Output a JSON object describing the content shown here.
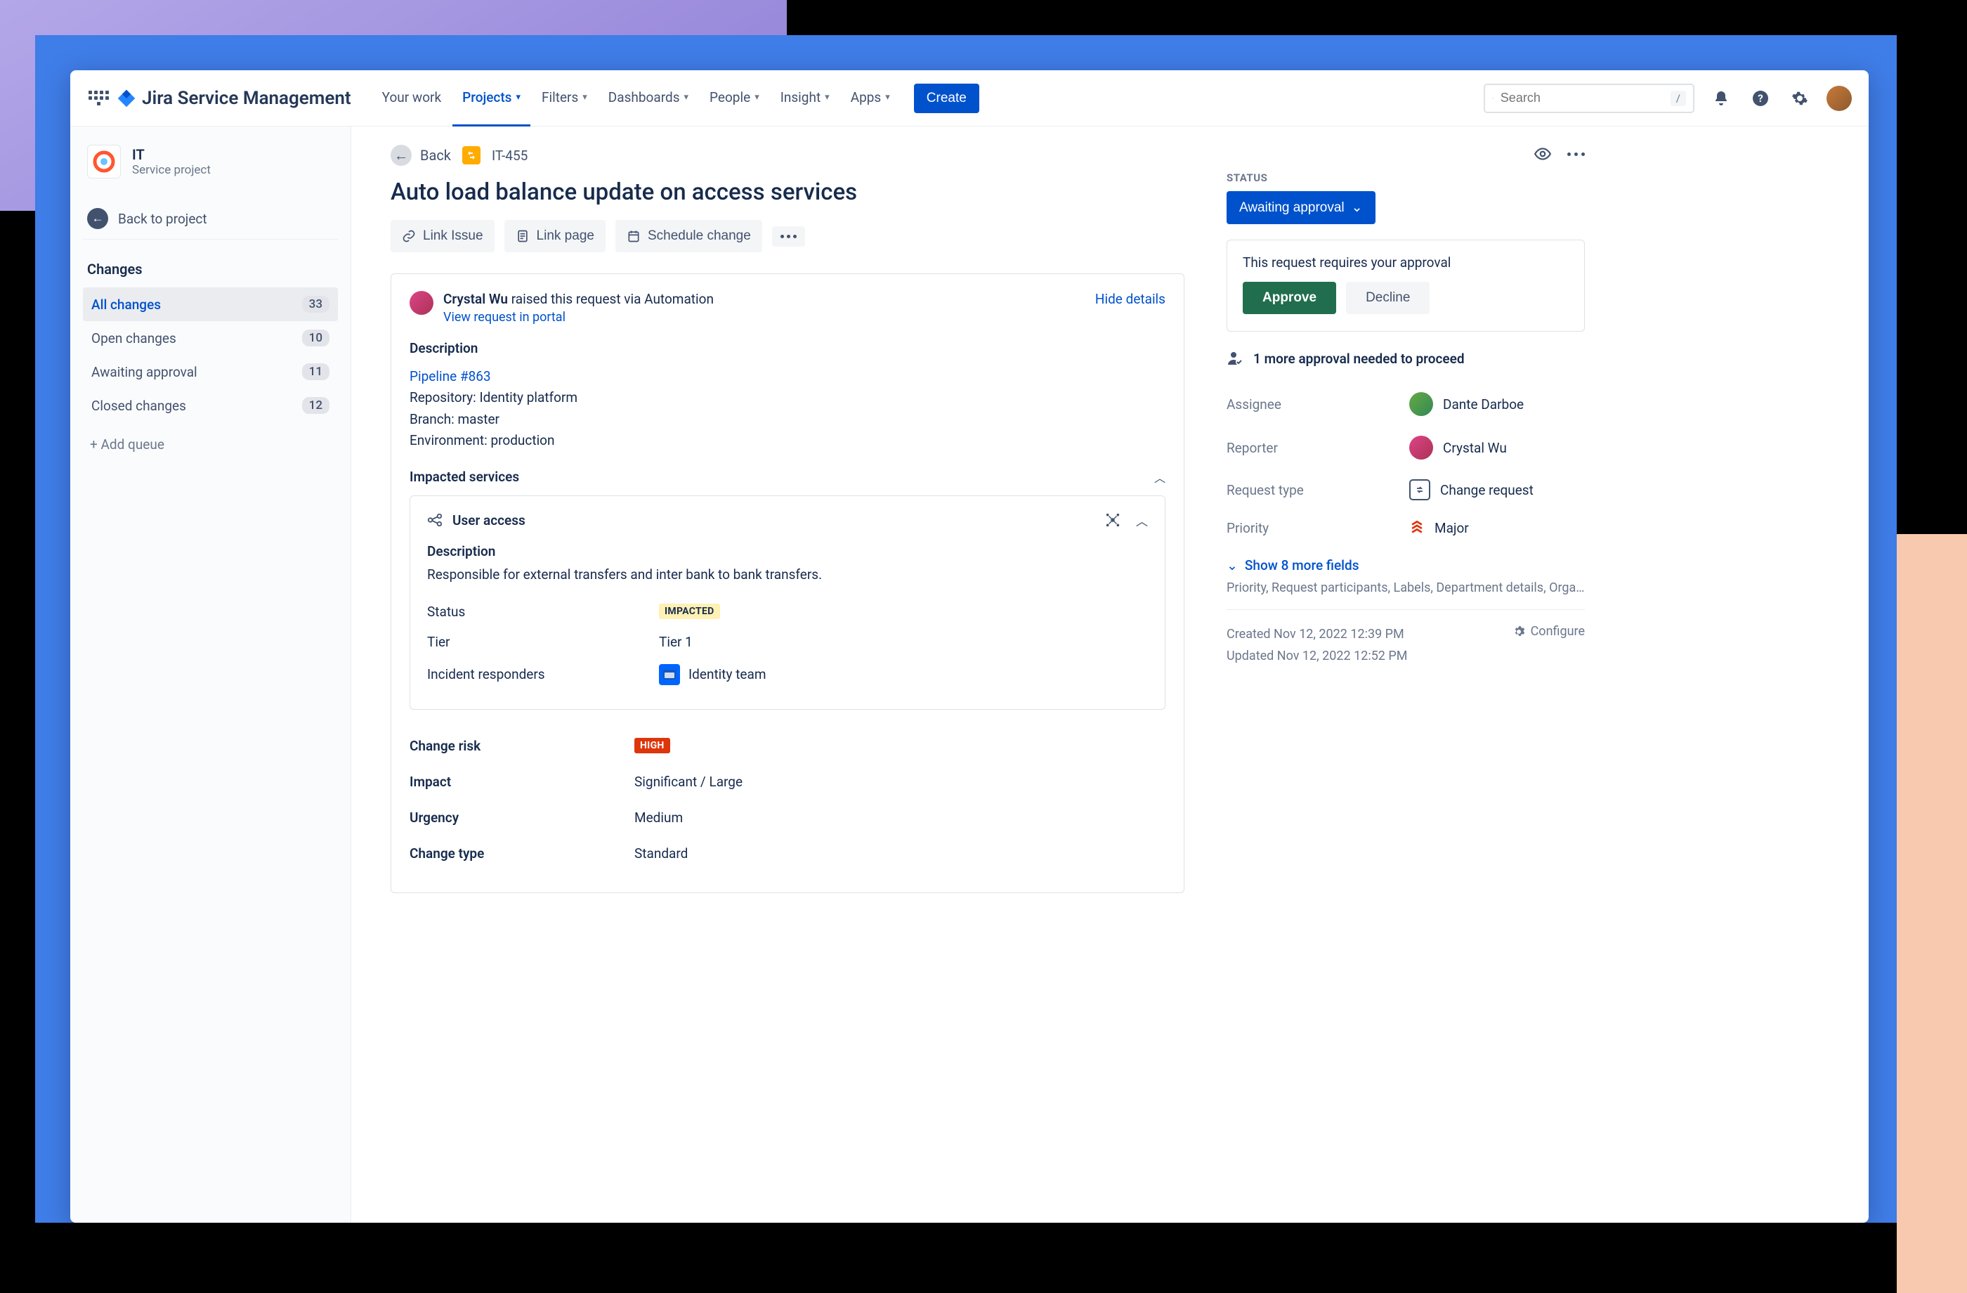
{
  "header": {
    "product": "Jira Service Management",
    "nav": {
      "your_work": "Your work",
      "projects": "Projects",
      "filters": "Filters",
      "dashboards": "Dashboards",
      "people": "People",
      "insight": "Insight",
      "apps": "Apps"
    },
    "create": "Create",
    "search_placeholder": "Search",
    "search_key": "/"
  },
  "sidebar": {
    "project_name": "IT",
    "project_type": "Service project",
    "back_to_project": "Back to project",
    "section": "Changes",
    "items": [
      {
        "label": "All changes",
        "count": "33"
      },
      {
        "label": "Open changes",
        "count": "10"
      },
      {
        "label": "Awaiting approval",
        "count": "11"
      },
      {
        "label": "Closed changes",
        "count": "12"
      }
    ],
    "add_queue": "+ Add queue"
  },
  "issue": {
    "back": "Back",
    "key": "IT-455",
    "title": "Auto load balance update on access services",
    "actions": {
      "link_issue": "Link Issue",
      "link_page": "Link page",
      "schedule": "Schedule change"
    },
    "requester": {
      "name": "Crystal Wu",
      "suffix": " raised this request via Automation"
    },
    "view_in_portal": "View request in portal",
    "hide_details": "Hide details",
    "desc_label": "Description",
    "desc": {
      "pipeline": "Pipeline #863",
      "repo": "Repository: Identity platform",
      "branch": "Branch: master",
      "env": "Environment: production"
    },
    "impacted_label": "Impacted services",
    "service": {
      "name": "User access",
      "desc_label": "Description",
      "desc": "Responsible for external transfers and inter bank to bank transfers.",
      "status_k": "Status",
      "status_v": "IMPACTED",
      "tier_k": "Tier",
      "tier_v": "Tier 1",
      "responders_k": "Incident responders",
      "responders_v": "Identity team"
    },
    "fields": {
      "risk_k": "Change risk",
      "risk_v": "HIGH",
      "impact_k": "Impact",
      "impact_v": "Significant / Large",
      "urgency_k": "Urgency",
      "urgency_v": "Medium",
      "type_k": "Change type",
      "type_v": "Standard"
    }
  },
  "right": {
    "status_label": "STATUS",
    "status_value": "Awaiting approval",
    "approval_text": "This request requires your approval",
    "approve": "Approve",
    "decline": "Decline",
    "approval_needed": "1 more approval needed to proceed",
    "assignee_k": "Assignee",
    "assignee_v": "Dante Darboe",
    "reporter_k": "Reporter",
    "reporter_v": "Crystal Wu",
    "reqtype_k": "Request type",
    "reqtype_v": "Change request",
    "priority_k": "Priority",
    "priority_v": "Major",
    "show_more": "Show 8 more fields",
    "hidden_fields": "Priority, Request participants, Labels, Department details, Organizations, T...",
    "created": "Created Nov 12, 2022 12:39 PM",
    "updated": "Updated Nov 12, 2022 12:52 PM",
    "configure": "Configure"
  }
}
